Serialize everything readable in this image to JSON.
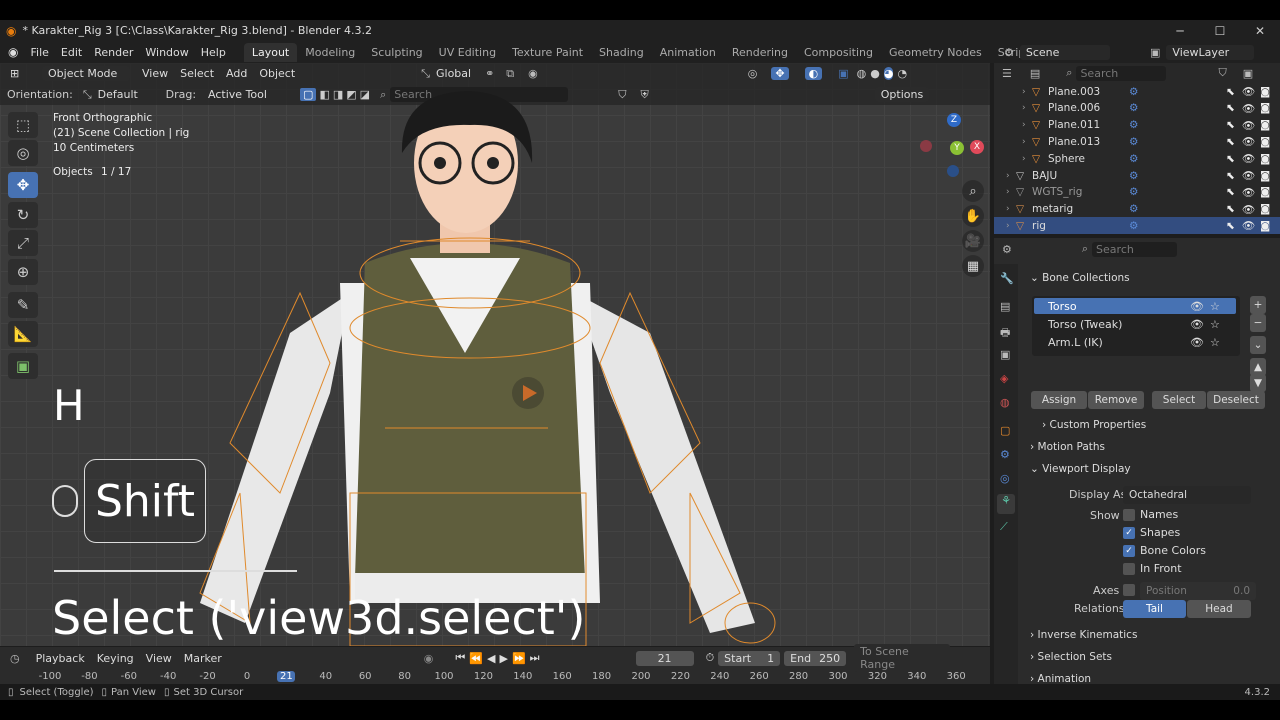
{
  "window": {
    "title": "* Karakter_Rig 3 [C:\\Class\\Karakter_Rig 3.blend] - Blender 4.3.2",
    "minimize_icon": "minimize-icon",
    "maximize_icon": "maximize-icon",
    "close_icon": "close-icon"
  },
  "menu": {
    "items": [
      "File",
      "Edit",
      "Render",
      "Window",
      "Help"
    ]
  },
  "workspaces": {
    "tabs": [
      "Layout",
      "Modeling",
      "Sculpting",
      "UV Editing",
      "Texture Paint",
      "Shading",
      "Animation",
      "Rendering",
      "Compositing",
      "Geometry Nodes",
      "Scripting"
    ],
    "active": "Layout",
    "add": "+"
  },
  "scene": {
    "label": "Scene",
    "viewlayer": "ViewLayer"
  },
  "viewport_header": {
    "mode": "Object Mode",
    "menus": [
      "View",
      "Select",
      "Add",
      "Object"
    ],
    "transform": "Global"
  },
  "tool_settings": {
    "orientation_label": "Orientation:",
    "orientation_value": "Default",
    "drag_label": "Drag:",
    "drag_value": "Active Tool",
    "search_placeholder": "Search",
    "options": "Options"
  },
  "viewport_info": {
    "view": "Front Orthographic",
    "collection": "(21) Scene Collection | rig",
    "scale": "10 Centimeters",
    "objects_label": "Objects",
    "objects_count": "1 / 17"
  },
  "gizmo": {
    "z": "Z",
    "y": "Y",
    "x": "X"
  },
  "overlay": {
    "key1": "H",
    "modifier": "Shift",
    "operator": "Select ('view3d.select')"
  },
  "outliner": {
    "search_placeholder": "Search",
    "rows": [
      {
        "name": "Plane.003",
        "indent": 1
      },
      {
        "name": "Plane.006",
        "indent": 1
      },
      {
        "name": "Plane.011",
        "indent": 1
      },
      {
        "name": "Plane.013",
        "indent": 1
      },
      {
        "name": "Sphere",
        "indent": 1
      },
      {
        "name": "BAJU",
        "indent": 0
      },
      {
        "name": "WGTS_rig",
        "indent": 0
      },
      {
        "name": "metarig",
        "indent": 0
      },
      {
        "name": "rig",
        "indent": 0
      }
    ]
  },
  "properties": {
    "search_placeholder": "Search",
    "bone_collections": {
      "title": "Bone Collections",
      "items": [
        "Torso",
        "Torso (Tweak)",
        "Arm.L (IK)"
      ],
      "active": "Torso"
    },
    "buttons": {
      "assign": "Assign",
      "remove": "Remove",
      "select": "Select",
      "deselect": "Deselect"
    },
    "custom_properties": "Custom Properties",
    "motion_paths": "Motion Paths",
    "viewport_display": {
      "title": "Viewport Display",
      "display_as_label": "Display As",
      "display_as_value": "Octahedral",
      "show_label": "Show",
      "names": "Names",
      "shapes": "Shapes",
      "bone_colors": "Bone Colors",
      "in_front": "In Front",
      "axes_label": "Axes",
      "position_label": "Position",
      "position_value": "0.0",
      "relations_label": "Relations",
      "tail": "Tail",
      "head": "Head"
    },
    "inverse_kinematics": "Inverse Kinematics",
    "selection_sets": "Selection Sets",
    "animation": "Animation"
  },
  "timeline": {
    "menus": [
      "Playback",
      "Keying",
      "View",
      "Marker"
    ],
    "current_frame": "21",
    "start_label": "Start",
    "start_value": "1",
    "end_label": "End",
    "end_value": "250",
    "scene_range": "To Scene Range",
    "ticks": [
      "-100",
      "-80",
      "-60",
      "-40",
      "-20",
      "0",
      "21",
      "40",
      "60",
      "80",
      "100",
      "120",
      "140",
      "160",
      "180",
      "200",
      "220",
      "240",
      "260",
      "280",
      "300",
      "320",
      "340",
      "360"
    ]
  },
  "statusbar": {
    "select": "Select (Toggle)",
    "pan": "Pan View",
    "cursor": "Set 3D Cursor",
    "version": "4.3.2"
  },
  "colors": {
    "accent": "#4772b3",
    "selection": "#334d80",
    "vest": "#5f5e3d",
    "bone_wire": "#e08a2c"
  }
}
